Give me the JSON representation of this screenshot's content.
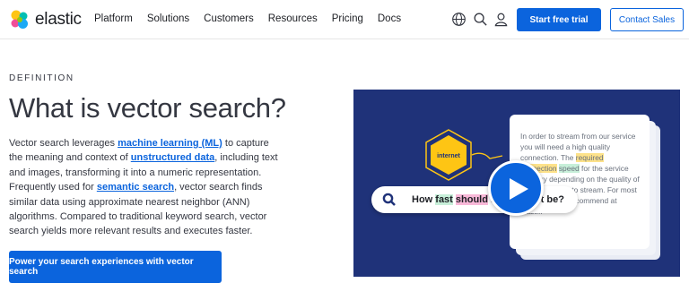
{
  "header": {
    "logo_text": "elastic",
    "nav": [
      "Platform",
      "Solutions",
      "Customers",
      "Resources",
      "Pricing",
      "Docs"
    ],
    "icons": [
      "globe-icon",
      "search-icon",
      "user-icon"
    ],
    "trial_label": "Start free trial",
    "sales_label": "Contact Sales"
  },
  "main": {
    "eyebrow": "DEFINITION",
    "title": "What is vector search?",
    "body": {
      "t1": "Vector search leverages ",
      "link1": "machine learning (ML)",
      "t2": " to capture the meaning and context of ",
      "link2": "unstructured data",
      "t3": ", including text and images, transforming it into a numeric representation. Frequently used for ",
      "link3": "semantic search",
      "t4": ", vector search finds similar data using approximate nearest neighbor (ANN) algorithms. Compared to traditional keyword search, vector search yields more relevant results and executes faster."
    },
    "cta_label": "Power your search experiences with vector search"
  },
  "illustration": {
    "hex_label": "internet",
    "doc": {
      "p1": "In order to stream from our service you will need a high quality connection. The ",
      "h1": "required",
      "sp1": " ",
      "h2": "connection",
      "sp2": " ",
      "h3": "speed",
      "p2": " for the service will vary depending on the quality of video you wish to stream. For most customers we recommend at least..."
    },
    "search": {
      "w1": "How ",
      "w2": "fast",
      "w3": " ",
      "w4": "should",
      "w5": " my internet be?"
    }
  },
  "colors": {
    "brand_blue": "#0b64dd",
    "hero_bg": "#1f3279",
    "hex_yellow": "#fec514"
  }
}
